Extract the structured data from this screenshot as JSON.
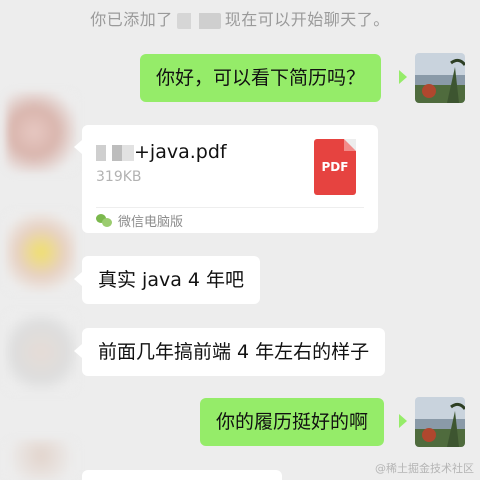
{
  "chat": {
    "system_notice_prefix": "你已添加了",
    "system_notice_suffix": "现在可以开始聊天了。",
    "messages": [
      {
        "from": "me",
        "type": "text",
        "text": "你好，可以看下简历吗？"
      },
      {
        "from": "contact",
        "type": "file",
        "file_name": "+java.pdf",
        "file_size": "319KB",
        "file_type": "PDF",
        "source": "微信电脑版"
      },
      {
        "from": "contact",
        "type": "text",
        "text": "真实 java 4 年吧"
      },
      {
        "from": "contact",
        "type": "text",
        "text": "前面几年搞前端 4 年左右的样子"
      },
      {
        "from": "me",
        "type": "text",
        "text": "你的履历挺好的啊"
      }
    ]
  },
  "watermark": "@稀土掘金技术社区",
  "colors": {
    "background": "#ededed",
    "my_bubble": "#95ec69",
    "their_bubble": "#ffffff",
    "pdf_red": "#e64340"
  },
  "icons": {
    "pdf": "pdf-file-icon",
    "source": "wechat-icon"
  }
}
